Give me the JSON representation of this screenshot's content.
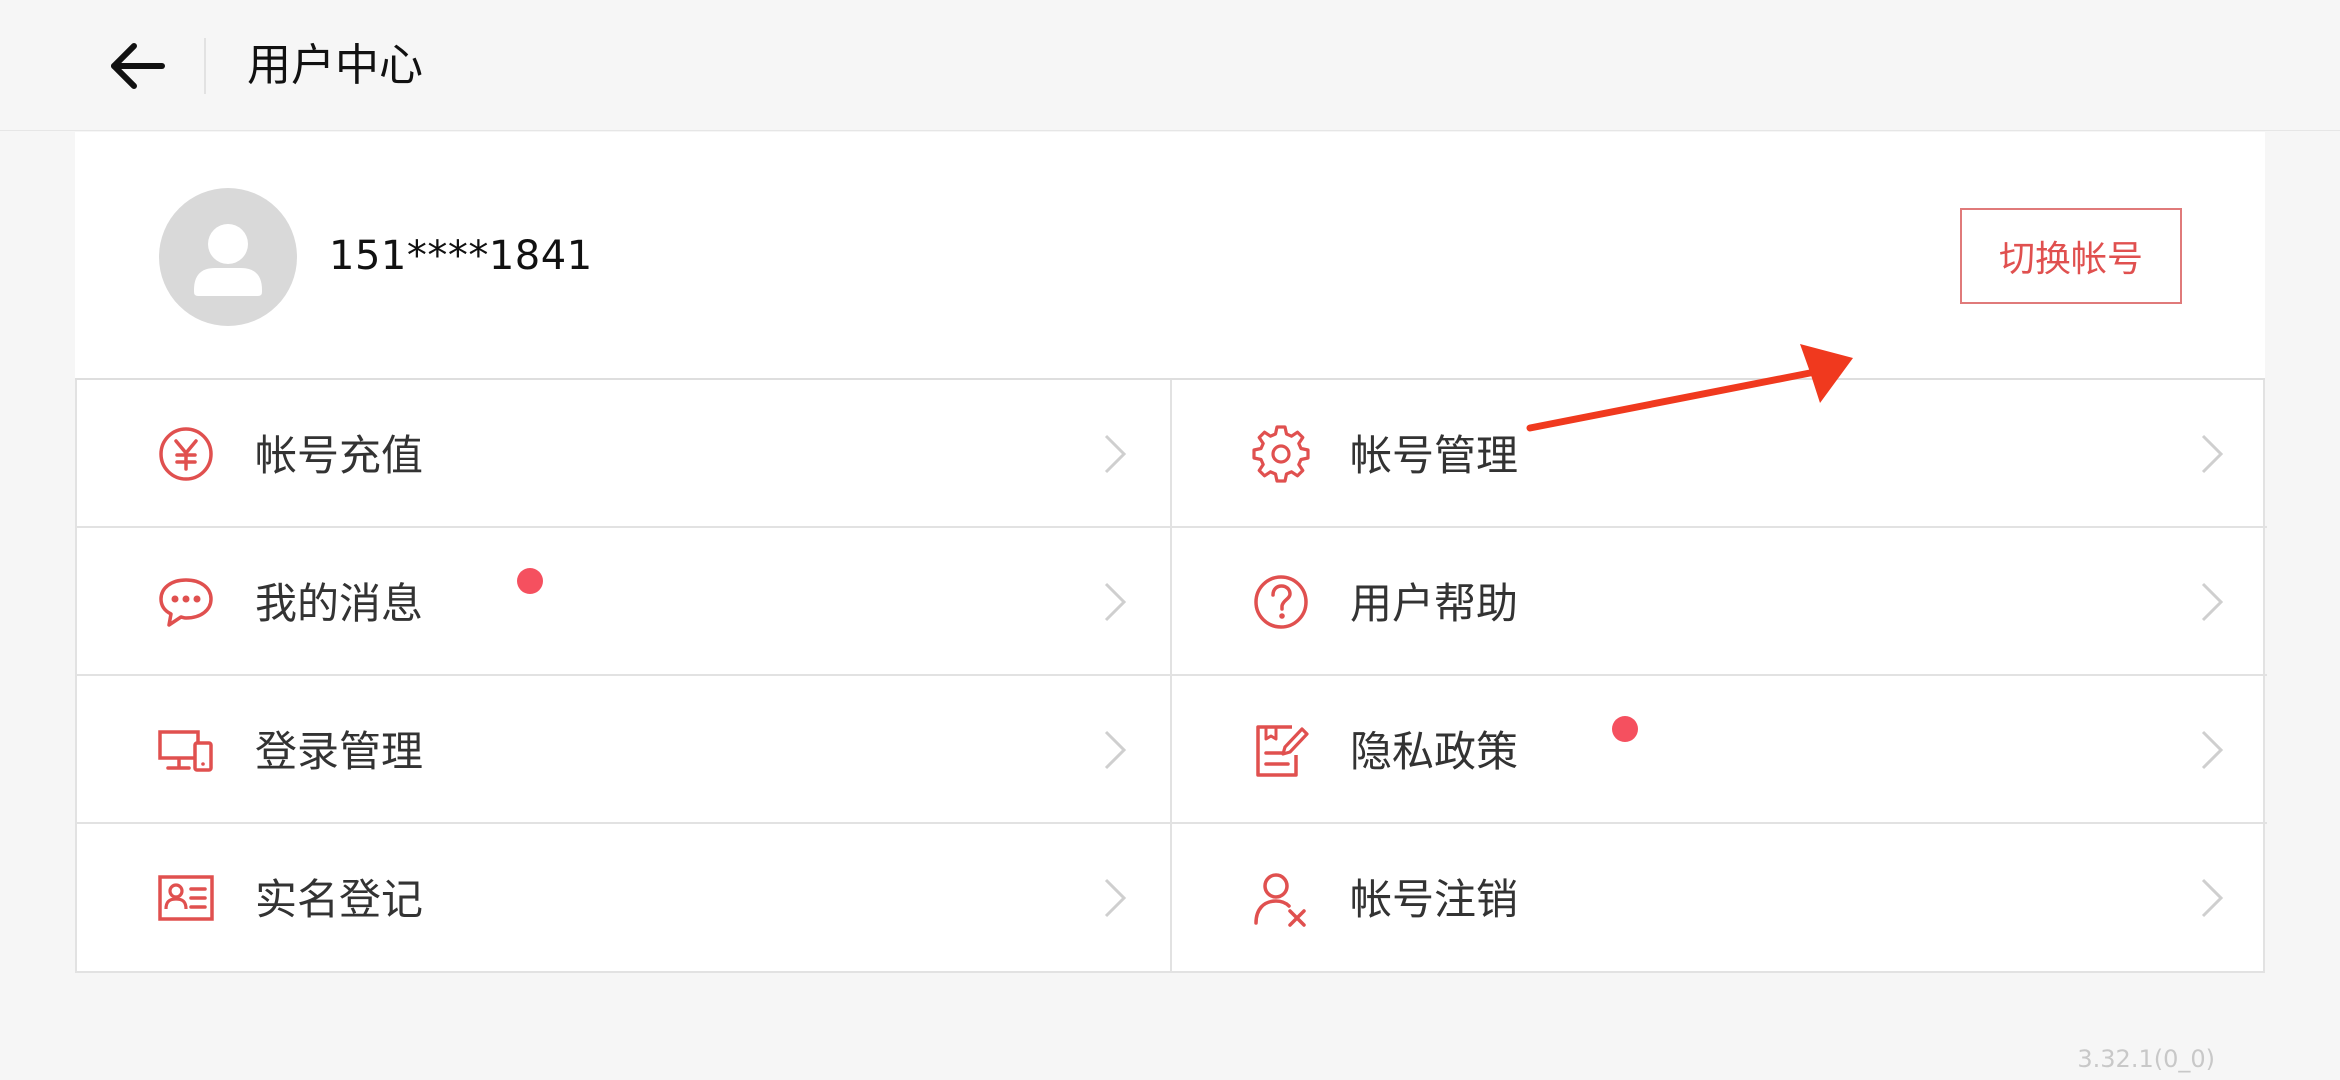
{
  "header": {
    "back_icon": "arrow-left-icon",
    "title": "用户中心"
  },
  "profile": {
    "avatar_icon": "user-avatar-icon",
    "username": "151****1841",
    "switch_label": "切换帐号",
    "annotation_icon": "red-arrow-icon"
  },
  "menu": {
    "items": [
      {
        "label": "帐号充值",
        "icon": "yuan-circle-icon",
        "badge": false
      },
      {
        "label": "帐号管理",
        "icon": "gear-icon",
        "badge": false
      },
      {
        "label": "我的消息",
        "icon": "chat-bubble-icon",
        "badge": true
      },
      {
        "label": "用户帮助",
        "icon": "question-circle-icon",
        "badge": false
      },
      {
        "label": "登录管理",
        "icon": "devices-icon",
        "badge": false
      },
      {
        "label": "隐私政策",
        "icon": "document-edit-icon",
        "badge": true
      },
      {
        "label": "实名登记",
        "icon": "id-card-icon",
        "badge": false
      },
      {
        "label": "帐号注销",
        "icon": "user-remove-icon",
        "badge": false
      }
    ]
  },
  "version": "3.32.1(0_0)",
  "colors": {
    "accent": "#e0504f",
    "badge": "#f5505f",
    "annotation": "#f0391e"
  }
}
